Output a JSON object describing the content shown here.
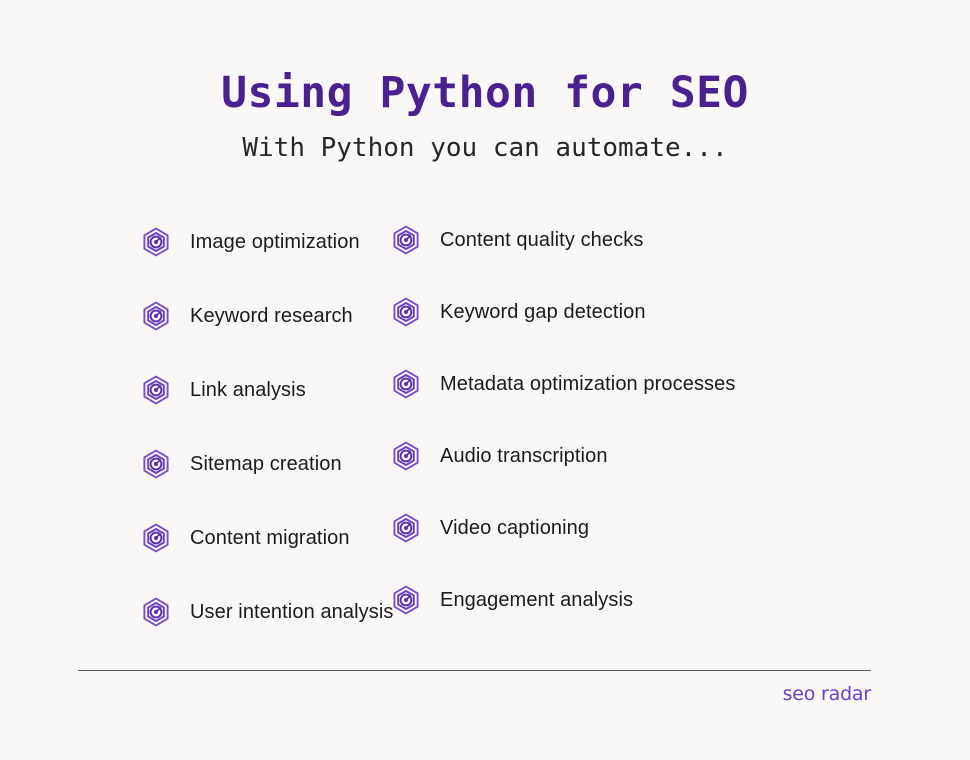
{
  "header": {
    "title": "Using Python for SEO",
    "subtitle": "With Python you can automate..."
  },
  "columns": {
    "left": {
      "items": [
        {
          "icon": "radar-hexagon-icon",
          "label": "Image optimization"
        },
        {
          "icon": "radar-hexagon-icon",
          "label": "Keyword research"
        },
        {
          "icon": "radar-hexagon-icon",
          "label": "Link analysis"
        },
        {
          "icon": "radar-hexagon-icon",
          "label": "Sitemap creation"
        },
        {
          "icon": "radar-hexagon-icon",
          "label": "Content migration"
        },
        {
          "icon": "radar-hexagon-icon",
          "label": "User intention analysis"
        }
      ]
    },
    "right": {
      "items": [
        {
          "icon": "radar-hexagon-icon",
          "label": "Content quality checks"
        },
        {
          "icon": "radar-hexagon-icon",
          "label": "Keyword gap detection"
        },
        {
          "icon": "radar-hexagon-icon",
          "label": "Metadata optimization processes"
        },
        {
          "icon": "radar-hexagon-icon",
          "label": "Audio transcription"
        },
        {
          "icon": "radar-hexagon-icon",
          "label": "Video captioning"
        },
        {
          "icon": "radar-hexagon-icon",
          "label": "Engagement analysis"
        }
      ]
    }
  },
  "footer": {
    "brand": "seo radar"
  },
  "colors": {
    "background": "#faf8f6",
    "title_purple": "#4b2191",
    "brand_purple": "#6b3fc4",
    "icon_purple_outer": "#7b4fc9",
    "icon_purple_inner": "#5c2fa8",
    "text_dark": "#1b1b1f",
    "divider": "#3c3a3d"
  }
}
